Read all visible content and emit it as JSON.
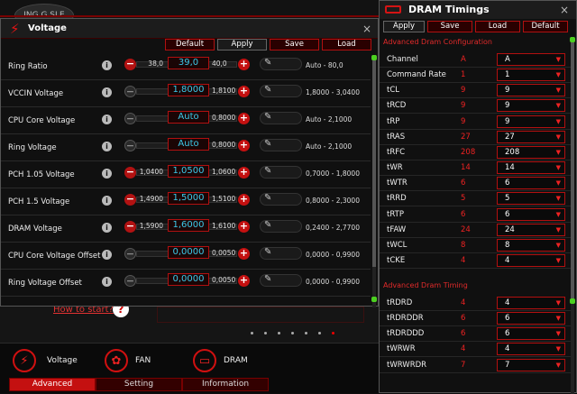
{
  "background": {
    "logo_text": "ING G SLE",
    "how_to_start": "How to start?",
    "question_mark": "?",
    "dock": {
      "voltage_label": "Voltage",
      "fan_label": "FAN",
      "dram_label": "DRAM",
      "tabs": [
        "Advanced",
        "Setting",
        "Information"
      ],
      "active_tab": 0
    },
    "page_dots": 7,
    "active_dot": 6
  },
  "voltage_panel": {
    "title": "Voltage",
    "close": "×",
    "buttons": [
      "Default",
      "Apply",
      "Save",
      "Load"
    ],
    "rows": [
      {
        "label": "Ring Ratio",
        "low": "38,0",
        "value": "39,0",
        "high": "40,0",
        "range": "Auto - 80,0",
        "minus_active": true
      },
      {
        "label": "VCCIN Voltage",
        "low": "",
        "value": "1,8000",
        "high": "1,8100",
        "range": "1,8000 - 3,0400",
        "minus_active": false
      },
      {
        "label": "CPU Core Voltage",
        "low": "",
        "value": "Auto",
        "high": "0,8000",
        "range": "Auto - 2,1000",
        "minus_active": false
      },
      {
        "label": "Ring Voltage",
        "low": "",
        "value": "Auto",
        "high": "0,8000",
        "range": "Auto - 2,1000",
        "minus_active": false
      },
      {
        "label": "PCH 1.05 Voltage",
        "low": "1,0400",
        "value": "1,0500",
        "high": "1,0600",
        "range": "0,7000 - 1,8000",
        "minus_active": true
      },
      {
        "label": "PCH 1.5 Voltage",
        "low": "1,4900",
        "value": "1,5000",
        "high": "1,5100",
        "range": "0,8000 - 2,3000",
        "minus_active": true
      },
      {
        "label": "DRAM Voltage",
        "low": "1,5900",
        "value": "1,6000",
        "high": "1,6100",
        "range": "0,2400 - 2,7700",
        "minus_active": true
      },
      {
        "label": "CPU Core Voltage Offset",
        "low": "",
        "value": "0,0000",
        "high": "0,0050",
        "range": "0,0000 - 0,9900",
        "minus_active": false
      },
      {
        "label": "Ring Voltage Offset",
        "low": "",
        "value": "0,0000",
        "high": "0,0050",
        "range": "0,0000 - 0,9900",
        "minus_active": false
      }
    ],
    "icons": {
      "info": "i",
      "minus": "−",
      "plus": "+",
      "pen": "✎"
    }
  },
  "dram_panel": {
    "title": "DRAM Timings",
    "close": "×",
    "buttons": [
      "Apply",
      "Save",
      "Load",
      "Default"
    ],
    "section_advanced_config": "Advanced Dram Configuration",
    "section_advanced_timing": "Advanced Dram Timing",
    "config_rows": [
      {
        "label": "Channel",
        "current": "A",
        "select": "A"
      },
      {
        "label": "Command Rate",
        "current": "1",
        "select": "1"
      },
      {
        "label": "tCL",
        "current": "9",
        "select": "9"
      },
      {
        "label": "tRCD",
        "current": "9",
        "select": "9"
      },
      {
        "label": "tRP",
        "current": "9",
        "select": "9"
      },
      {
        "label": "tRAS",
        "current": "27",
        "select": "27"
      },
      {
        "label": "tRFC",
        "current": "208",
        "select": "208"
      },
      {
        "label": "tWR",
        "current": "14",
        "select": "14"
      },
      {
        "label": "tWTR",
        "current": "6",
        "select": "6"
      },
      {
        "label": "tRRD",
        "current": "5",
        "select": "5"
      },
      {
        "label": "tRTP",
        "current": "6",
        "select": "6"
      },
      {
        "label": "tFAW",
        "current": "24",
        "select": "24"
      },
      {
        "label": "tWCL",
        "current": "8",
        "select": "8"
      },
      {
        "label": "tCKE",
        "current": "4",
        "select": "4"
      }
    ],
    "timing_rows": [
      {
        "label": "tRDRD",
        "current": "4",
        "select": "4"
      },
      {
        "label": "tRDRDDR",
        "current": "6",
        "select": "6"
      },
      {
        "label": "tRDRDDD",
        "current": "6",
        "select": "6"
      },
      {
        "label": "tWRWR",
        "current": "4",
        "select": "4"
      },
      {
        "label": "tWRWRDR",
        "current": "7",
        "select": "7"
      }
    ],
    "dropdown_arrow": "▼"
  },
  "colors": {
    "accent": "#c41010",
    "value_text": "#3cc8e8",
    "scroll_marker": "#4cd020"
  }
}
